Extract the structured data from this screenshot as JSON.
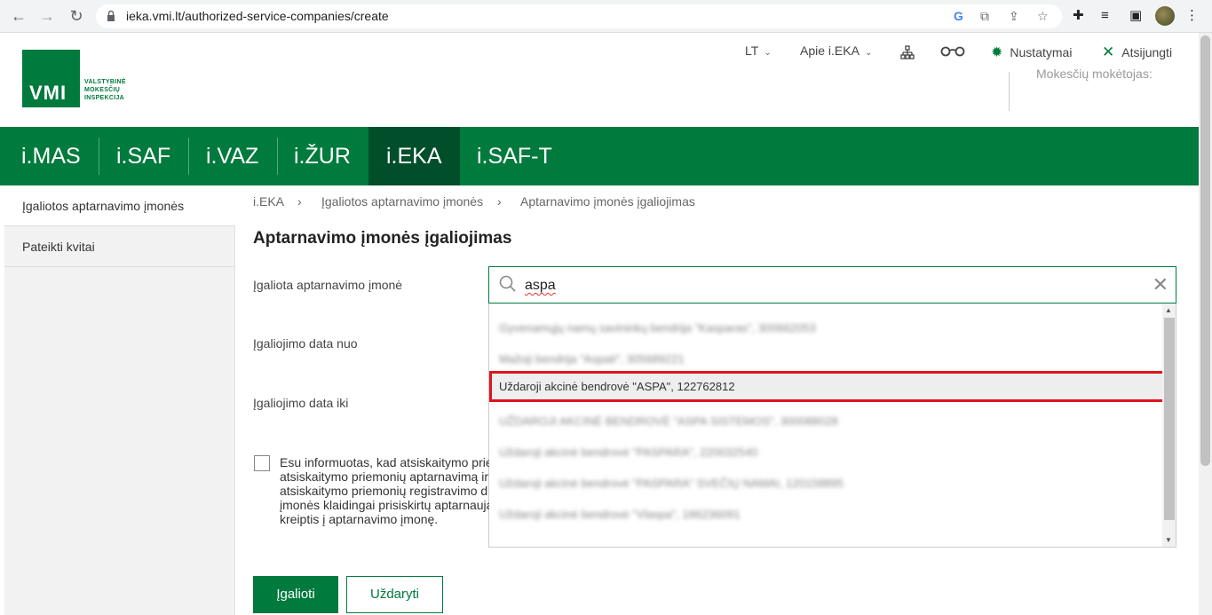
{
  "browser": {
    "url": "ieka.vmi.lt/authorized-service-companies/create"
  },
  "header": {
    "logo_text": "VMI",
    "logo_subtitle_1": "VALSTYBINĖ",
    "logo_subtitle_2": "MOKESČIŲ",
    "logo_subtitle_3": "INSPEKCIJA",
    "language": "LT",
    "about": "Apie i.EKA",
    "settings": "Nustatymai",
    "logout": "Atsijungti",
    "taxpayer_label": "Mokesčių mokėtojas:"
  },
  "mainnav": {
    "items": [
      "i.MAS",
      "i.SAF",
      "i.VAZ",
      "i.ŽUR",
      "i.EKA",
      "i.SAF-T"
    ],
    "active": "i.EKA"
  },
  "sidebar": {
    "items": [
      "Įgaliotos aptarnavimo įmonės",
      "Pateikti kvitai"
    ]
  },
  "breadcrumb": [
    "i.EKA",
    "Įgaliotos aptarnavimo įmonės",
    "Aptarnavimo įmonės įgaliojimas"
  ],
  "page_title": "Aptarnavimo įmonės įgaliojimas",
  "form": {
    "company_label": "Įgaliota aptarnavimo įmonė",
    "date_from_label": "Įgaliojimo data nuo",
    "date_to_label": "Įgaliojimo data iki",
    "search_value": "aspa",
    "info_lines": [
      "Esu informuotas, kad atsiskaitymo prie",
      "atsiskaitymo priemonių aptarnavimą ir",
      "atsiskaitymo priemonių registravimo d",
      "įmonės klaidingai prisiskirtų aptarnauja",
      "kreiptis į aptarnavimo įmonę."
    ]
  },
  "dropdown": {
    "items": [
      "Gyvenamųjų namų savininkų bendrija \"Kasparas\", 300662053",
      "Mažoji bendrija \"Aspati\", 305689221",
      "Uždaroji akcinė bendrovė \"ASPA\", 122762812",
      "UŽDAROJI AKCINĖ BENDROVĖ \"ASPA SISTEMOS\", 300088028",
      "Uždaroji akcinė bendrovė \"PASPARA\", 220032540",
      "Uždaroji akcinė bendrovė \"PASPARA\" SVEČIŲ NAMAI, 120158895",
      "Uždaroji akcinė bendrovė \"Vlaspa\", 186236091"
    ],
    "highlighted_index": 2
  },
  "buttons": {
    "authorize": "Įgalioti",
    "close": "Uždaryti"
  },
  "colors": {
    "brand_green": "#007a3d",
    "active_nav": "#004f2a",
    "highlight_border": "#e0141e"
  }
}
